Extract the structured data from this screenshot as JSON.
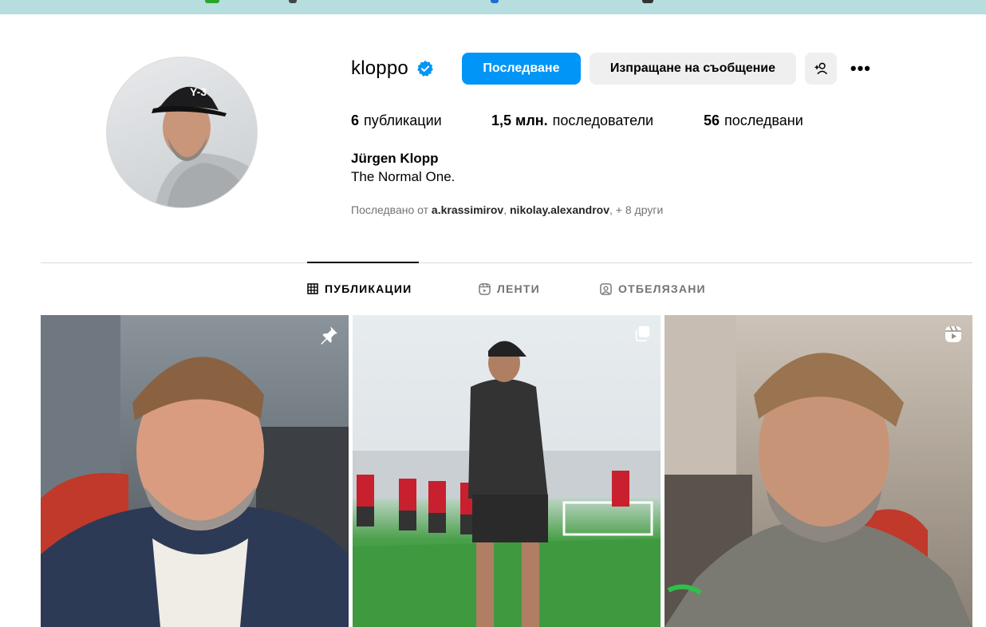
{
  "profile": {
    "username": "kloppo",
    "follow_label": "Последване",
    "message_label": "Изпращане на съобщение",
    "more_label": "•••",
    "stats": {
      "posts_count": "6",
      "posts_label": "публикации",
      "followers_count": "1,5 млн.",
      "followers_label": "последователи",
      "following_count": "56",
      "following_label": "последвани"
    },
    "full_name": "Jürgen Klopp",
    "bio": "The Normal One.",
    "followed_by": {
      "prefix": "Последвано от",
      "account_1": "a.krassimirov",
      "separator": ",",
      "account_2": "nikolay.alexandrov",
      "suffix": ", + 8 други"
    }
  },
  "tabs": [
    {
      "label": "ПУБЛИКАЦИИ",
      "icon": "grid-icon",
      "active": true
    },
    {
      "label": "ЛЕНТИ",
      "icon": "reels-icon",
      "active": false
    },
    {
      "label": "ОТБЕЛЯЗАНИ",
      "icon": "tagged-icon",
      "active": false
    }
  ],
  "posts": [
    {
      "icon": "pin-icon"
    },
    {
      "icon": "carousel-icon"
    },
    {
      "icon": "reel-icon"
    }
  ],
  "colors": {
    "accent": "#0095f6",
    "verified": "#0095f6",
    "top_strip": "#b6dede"
  }
}
